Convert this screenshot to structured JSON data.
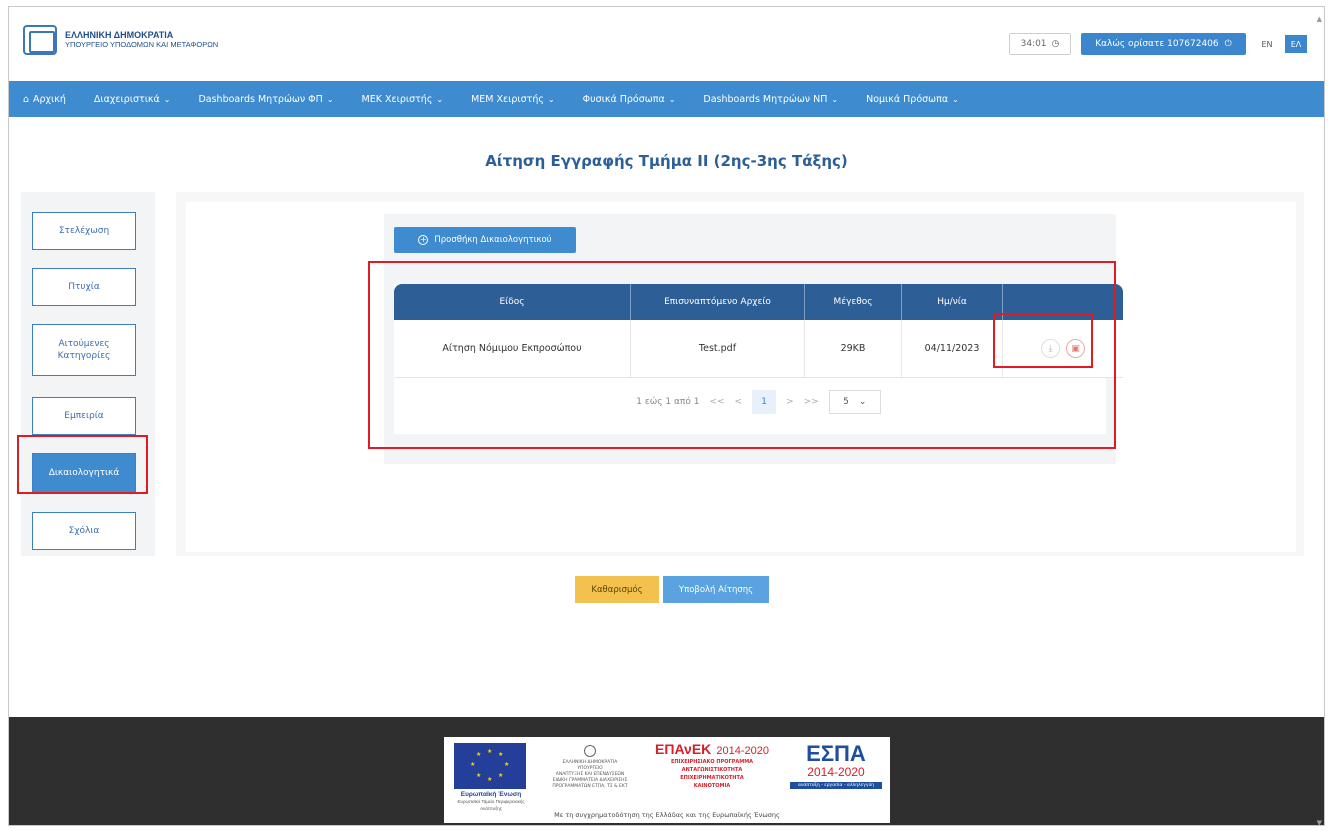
{
  "header": {
    "logo_line1": "ΕΛΛΗΝΙΚΗ ΔΗΜΟΚΡΑΤΙΑ",
    "logo_line2": "ΥΠΟΥΡΓΕΙΟ ΥΠΟΔΟΜΩΝ ΚΑΙ ΜΕΤΑΦΟΡΩΝ",
    "clock": "34:01",
    "welcome": "Καλώς ορίσατε 107672406",
    "lang_en": "EN",
    "lang_el": "ΕΛ"
  },
  "nav": {
    "home": "Αρχική",
    "items": [
      "Διαχειριστικά",
      "Dashboards Μητρώων ΦΠ",
      "ΜΕΚ Χειριστής",
      "ΜΕΜ Χειριστής",
      "Φυσικά Πρόσωπα",
      "Dashboards Μητρώων ΝΠ",
      "Νομικά Πρόσωπα"
    ]
  },
  "page": {
    "title": "Αίτηση Εγγραφής Τμήμα ΙΙ (2ης-3ης Τάξης)"
  },
  "sidebar": {
    "items": [
      "Στελέχωση",
      "Πτυχία",
      "Αιτούμενες Κατηγορίες",
      "Εμπειρία",
      "Δικαιολογητικά",
      "Σχόλια"
    ],
    "active": "Δικαιολογητικά"
  },
  "documents": {
    "add_button": "Προσθήκη Δικαιολογητικού",
    "columns": [
      "Είδος",
      "Επισυναπτόμενο Αρχείο",
      "Μέγεθος",
      "Ημ/νία"
    ],
    "rows": [
      {
        "type": "Αίτηση Νόμιμου Εκπροσώπου",
        "file": "Test.pdf",
        "size": "29KB",
        "date": "04/11/2023"
      }
    ],
    "pagination": {
      "summary": "1 εώς 1 από 1",
      "first": "<<",
      "prev": "<",
      "current": "1",
      "next": ">",
      "last": ">>",
      "page_size": "5"
    }
  },
  "actions": {
    "clear": "Καθαρισμός",
    "submit": "Υποβολή Αίτησης"
  },
  "footer": {
    "eu_title": "Ευρωπαϊκή Ένωση",
    "eu_sub": "Ευρωπαϊκό Ταμείο Περιφερειακής Ανάπτυξης",
    "ministry_lines": [
      "ΕΛΛΗΝΙΚΗ ΔΗΜΟΚΡΑΤΙΑ",
      "ΥΠΟΥΡΓΕΙΟ",
      "ΑΝΑΠΤΥΞΗΣ ΚΑΙ ΕΠΕΝΔΥΣΕΩΝ",
      "ΕΙΔΙΚΗ ΓΡΑΜΜΑΤΕΙΑ ΔΙΑΧΕΙΡΙΣΗΣ",
      "ΠΡΟΓΡΑΜΜΑΤΩΝ ΕΤΠΑ, ΤΣ & ΕΚΤ"
    ],
    "epanek_title": "ΕΠΑνΕΚ",
    "epanek_years": "2014-2020",
    "epanek_lines": [
      "ΕΠΙΧΕΙΡΗΣΙΑΚΟ ΠΡΟΓΡΑΜΜΑ",
      "ΑΝΤΑΓΩΝΙΣΤΙΚΟΤΗΤΑ",
      "ΕΠΙΧΕΙΡΗΜΑΤΙΚΟΤΗΤΑ",
      "ΚΑΙΝΟΤΟΜΙΑ"
    ],
    "espa_title": "ΕΣΠΑ",
    "espa_years": "2014-2020",
    "espa_tagline": "ανάπτυξη - εργασία - αλληλεγγύη",
    "cofund": "Με τη συγχρηματοδότηση της Ελλάδας και της Ευρωπαϊκής Ένωσης"
  },
  "colors": {
    "primary": "#3e8bd0",
    "table_header": "#2d5e95",
    "highlight": "#e01b24",
    "clear_button": "#f2c14e",
    "footer_bg": "#2f2f2f"
  }
}
